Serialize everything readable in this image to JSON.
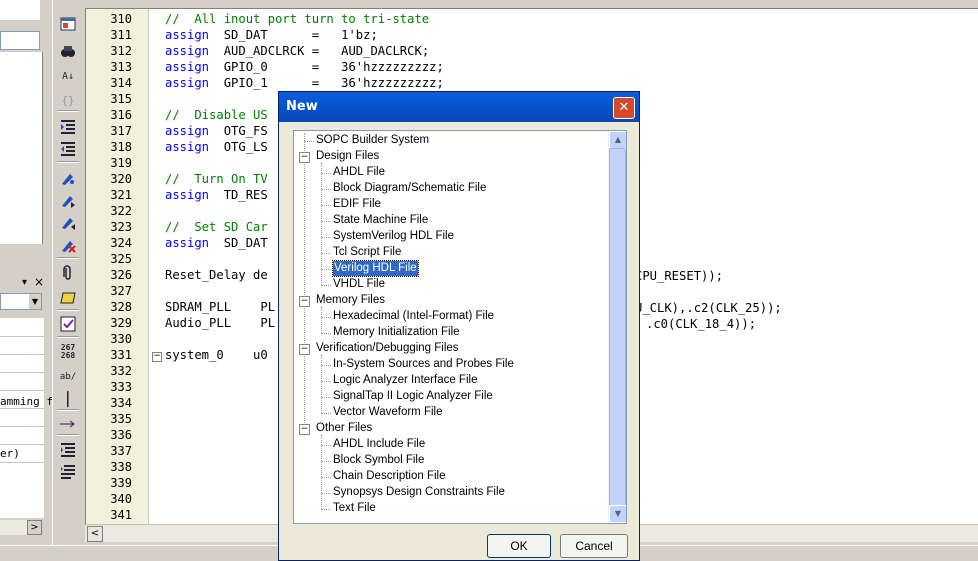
{
  "left_panel": {
    "text_1": "amming f",
    "text_2": "er)",
    "pin_icon": "pin-icon",
    "close_label": "×",
    "scroll_right": ">"
  },
  "toolbar": {
    "icons": [
      "new-file-icon",
      "find-icon",
      "replace-icon",
      "braces-icon",
      "indent-icon",
      "unindent-icon",
      "bookmark-icon",
      "bookmark-next-icon",
      "bookmark-prev-icon",
      "bookmark-clear-icon",
      "attach-icon",
      "insert-block-icon",
      "insert-template-icon",
      "line-number-icon",
      "ab-icon",
      "line-icon",
      "arrow-icon",
      "list-icon",
      "swap-icon"
    ],
    "line_number_label_top": "267",
    "line_number_label_bottom": "268",
    "ab_label": "ab/"
  },
  "editor": {
    "lines": [
      {
        "n": "310",
        "code": [
          {
            "t": "//  All inout port turn to tri-state",
            "c": "cm"
          }
        ]
      },
      {
        "n": "311",
        "code": [
          {
            "t": "assign",
            "c": "kw"
          },
          {
            "t": "  SD_DAT      =   1'bz;",
            "c": ""
          }
        ]
      },
      {
        "n": "312",
        "code": [
          {
            "t": "assign",
            "c": "kw"
          },
          {
            "t": "  AUD_ADCLRCK =   AUD_DACLRCK;",
            "c": ""
          }
        ]
      },
      {
        "n": "313",
        "code": [
          {
            "t": "assign",
            "c": "kw"
          },
          {
            "t": "  GPIO_0      =   36'hzzzzzzzzz;",
            "c": ""
          }
        ]
      },
      {
        "n": "314",
        "code": [
          {
            "t": "assign",
            "c": "kw"
          },
          {
            "t": "  GPIO_1      =   36'hzzzzzzzzz;",
            "c": ""
          }
        ]
      },
      {
        "n": "315",
        "code": []
      },
      {
        "n": "316",
        "code": [
          {
            "t": "//  Disable US",
            "c": "cm"
          }
        ]
      },
      {
        "n": "317",
        "code": [
          {
            "t": "assign",
            "c": "kw"
          },
          {
            "t": "  OTG_FS",
            "c": ""
          }
        ]
      },
      {
        "n": "318",
        "code": [
          {
            "t": "assign",
            "c": "kw"
          },
          {
            "t": "  OTG_LS",
            "c": ""
          }
        ]
      },
      {
        "n": "319",
        "code": []
      },
      {
        "n": "320",
        "code": [
          {
            "t": "//  Turn On TV",
            "c": "cm"
          }
        ]
      },
      {
        "n": "321",
        "code": [
          {
            "t": "assign",
            "c": "kw"
          },
          {
            "t": "  TD_RES",
            "c": ""
          }
        ]
      },
      {
        "n": "322",
        "code": []
      },
      {
        "n": "323",
        "code": [
          {
            "t": "//  Set SD Car",
            "c": "cm"
          }
        ]
      },
      {
        "n": "324",
        "code": [
          {
            "t": "assign",
            "c": "kw"
          },
          {
            "t": "  SD_DAT",
            "c": ""
          }
        ]
      },
      {
        "n": "325",
        "code": []
      },
      {
        "n": "326",
        "code": [
          {
            "t": "Reset_Delay de",
            "c": ""
          }
        ]
      },
      {
        "n": "327",
        "code": []
      },
      {
        "n": "328",
        "code": [
          {
            "t": "SDRAM_PLL    PL",
            "c": ""
          }
        ]
      },
      {
        "n": "329",
        "code": [
          {
            "t": "Audio_PLL    PL",
            "c": ""
          }
        ]
      },
      {
        "n": "330",
        "code": []
      },
      {
        "n": "331",
        "code": [
          {
            "t": "system_0    u0",
            "c": ""
          }
        ]
      },
      {
        "n": "332",
        "code": []
      },
      {
        "n": "333",
        "code": []
      },
      {
        "n": "334",
        "code": []
      },
      {
        "n": "335",
        "code": []
      },
      {
        "n": "336",
        "code": []
      },
      {
        "n": "337",
        "code": []
      },
      {
        "n": "338",
        "code": []
      },
      {
        "n": "339",
        "code": []
      },
      {
        "n": "340",
        "code": []
      },
      {
        "n": "341",
        "code": []
      }
    ],
    "right_fragments": {
      "line_326": "CPU_RESET));",
      "line_328": "U_CLK),.c2(CLK_25));",
      "line_329": ".c0(CLK_18_4));"
    },
    "fold_marker": "−"
  },
  "dialog": {
    "title": "New",
    "close_label": "✕",
    "tree": [
      {
        "label": "SOPC Builder System",
        "level": 0,
        "toggle": null
      },
      {
        "label": "Design Files",
        "level": 0,
        "toggle": "−"
      },
      {
        "label": "AHDL File",
        "level": 1
      },
      {
        "label": "Block Diagram/Schematic File",
        "level": 1
      },
      {
        "label": "EDIF File",
        "level": 1
      },
      {
        "label": "State Machine File",
        "level": 1
      },
      {
        "label": "SystemVerilog HDL File",
        "level": 1
      },
      {
        "label": "Tcl Script File",
        "level": 1
      },
      {
        "label": "Verilog HDL File",
        "level": 1,
        "selected": true
      },
      {
        "label": "VHDL File",
        "level": 1
      },
      {
        "label": "Memory Files",
        "level": 0,
        "toggle": "−"
      },
      {
        "label": "Hexadecimal (Intel-Format) File",
        "level": 1
      },
      {
        "label": "Memory Initialization File",
        "level": 1
      },
      {
        "label": "Verification/Debugging Files",
        "level": 0,
        "toggle": "−"
      },
      {
        "label": "In-System Sources and Probes File",
        "level": 1
      },
      {
        "label": "Logic Analyzer Interface File",
        "level": 1
      },
      {
        "label": "SignalTap II Logic Analyzer File",
        "level": 1
      },
      {
        "label": "Vector Waveform File",
        "level": 1
      },
      {
        "label": "Other Files",
        "level": 0,
        "toggle": "−"
      },
      {
        "label": "AHDL Include File",
        "level": 1
      },
      {
        "label": "Block Symbol File",
        "level": 1
      },
      {
        "label": "Chain Description File",
        "level": 1
      },
      {
        "label": "Synopsys Design Constraints File",
        "level": 1
      },
      {
        "label": "Text File",
        "level": 1
      }
    ],
    "scroll_up": "▲",
    "scroll_down": "▼",
    "ok_label": "OK",
    "cancel_label": "Cancel"
  },
  "hscroll": {
    "left_arrow": "<"
  }
}
